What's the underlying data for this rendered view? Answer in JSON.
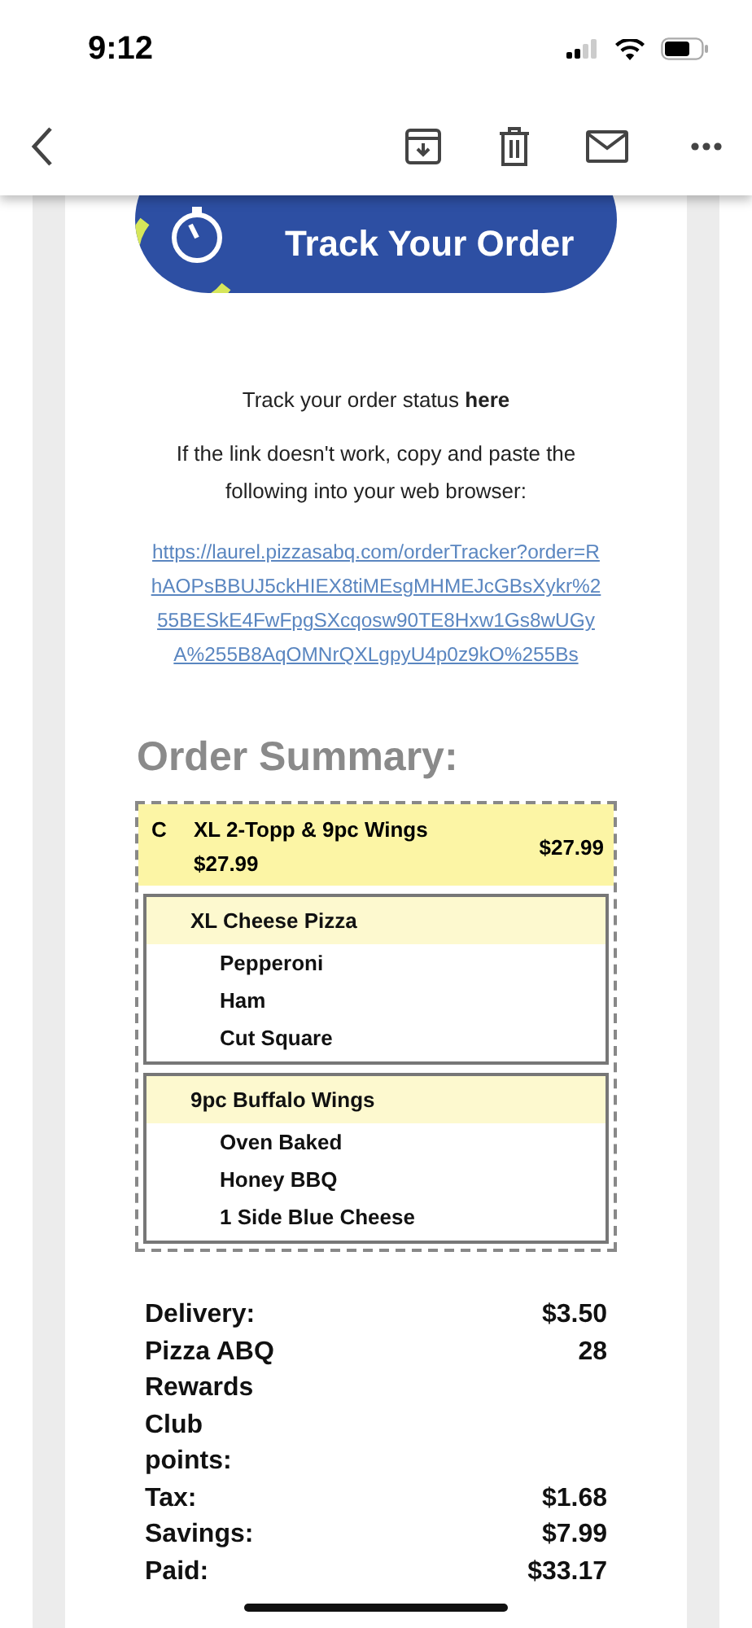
{
  "status_bar": {
    "time": "9:12"
  },
  "banner": {
    "label": "Track Your Order"
  },
  "track_line": "Track your order status **here**",
  "fallback_text": "If the link doesn't work, copy and paste the following into your web browser:",
  "tracker_url_lines": [
    "https://laurel.pizzasabq.com/orderTracker?order=R",
    "hAOPsBBUJ5ckHIEX8tiMEsgMHMEJcGBsXykr%2",
    "55BESkE4FwFpgSXcqosw90TE8Hxw1Gs8wUGy",
    "A%255B8AqOMNrQXLgpyU4p0z9kO%255Bs"
  ],
  "order": {
    "heading": "Order Summary:",
    "combo": {
      "code": "C",
      "name": "XL 2-Topp & 9pc Wings",
      "sub_price": "$27.99",
      "price": "$27.99"
    },
    "items": [
      {
        "name": "XL Cheese Pizza",
        "options": [
          "Pepperoni",
          "Ham",
          "Cut Square"
        ]
      },
      {
        "name": "9pc Buffalo Wings",
        "options": [
          "Oven Baked",
          "Honey BBQ",
          "1 Side Blue Cheese"
        ]
      }
    ]
  },
  "totals": [
    {
      "label": "Delivery:",
      "value": "$3.50"
    },
    {
      "label": "Pizza ABQ Rewards Club points:",
      "value": "28"
    },
    {
      "label": "Tax:",
      "value": "$1.68"
    },
    {
      "label": "Savings:",
      "value": "$7.99"
    },
    {
      "label": "Paid:",
      "value": "$33.17"
    }
  ]
}
